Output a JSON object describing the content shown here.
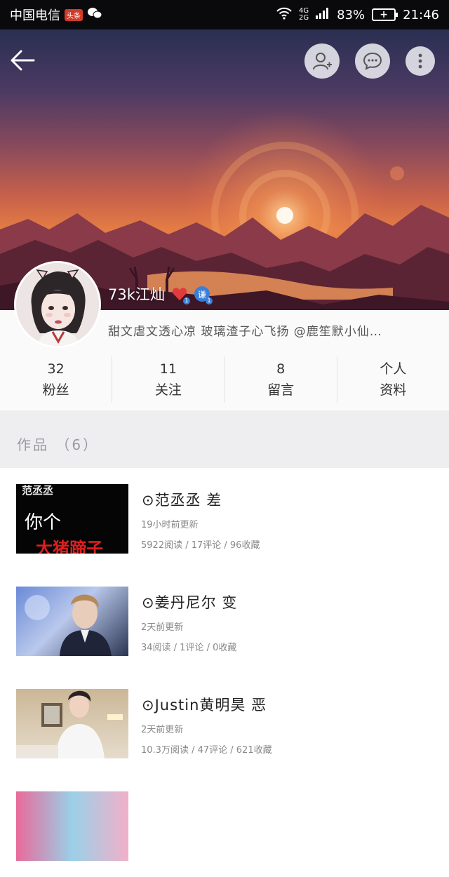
{
  "status_bar": {
    "carrier": "中国电信",
    "carrier_badge": "头条",
    "network_top": "4G",
    "network_bottom": "2G",
    "battery": "83%",
    "time": "21:46"
  },
  "profile": {
    "username": "73k江灿",
    "medal1_count": "1",
    "medal2_label": "谦",
    "medal2_count": "1",
    "bio": "甜文虐文透心凉 玻璃渣子心飞扬 @鹿笙默小仙…"
  },
  "stats": [
    {
      "top": "32",
      "bottom": "粉丝"
    },
    {
      "top": "11",
      "bottom": "关注"
    },
    {
      "top": "8",
      "bottom": "留言"
    },
    {
      "top": "个人",
      "bottom": "资料"
    }
  ],
  "section": {
    "title": "作品 （6）"
  },
  "thumb1_text": {
    "line1": "范丞丞",
    "line2": "你个",
    "line3": "大猪蹄子"
  },
  "works": [
    {
      "title": "⊙范丞丞 差",
      "updated": "19小时前更新",
      "stats": "5922阅读 / 17评论 / 96收藏"
    },
    {
      "title": "⊙姜丹尼尔 变",
      "updated": "2天前更新",
      "stats": "34阅读 / 1评论 / 0收藏"
    },
    {
      "title": "⊙Justin黄明昊 恶",
      "updated": "2天前更新",
      "stats": "10.3万阅读 / 47评论 / 621收藏"
    }
  ],
  "colors": {
    "accent_red": "#e03c3c",
    "medal_blue": "#3b7ed8",
    "section_bg": "#eeeef1"
  },
  "icons": [
    "back-arrow-icon",
    "add-friend-icon",
    "message-icon",
    "more-icon",
    "wifi-icon",
    "signal-icon",
    "battery-icon"
  ]
}
